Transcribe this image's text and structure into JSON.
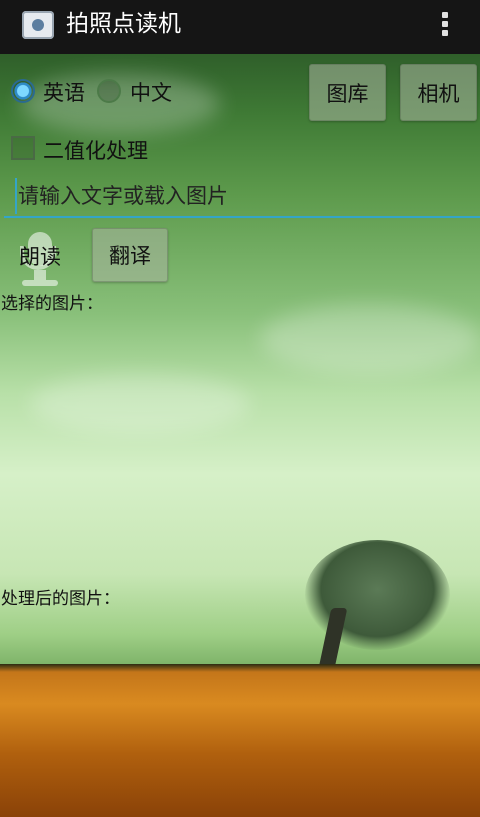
{
  "app": {
    "title": "拍照点读机"
  },
  "language": {
    "english_label": "英语",
    "chinese_label": "中文",
    "selected": "英语"
  },
  "buttons": {
    "gallery": "图库",
    "camera": "相机",
    "read_aloud": "朗读",
    "translate": "翻译"
  },
  "binarize": {
    "label": "二值化处理",
    "checked": false
  },
  "text_input": {
    "placeholder": "请输入文字或载入图片",
    "value": ""
  },
  "labels": {
    "selected_image": "选择的图片：",
    "processed_image": "处理后的图片："
  },
  "colors": {
    "accent": "#34a5c8",
    "statusbar": "#151515"
  }
}
